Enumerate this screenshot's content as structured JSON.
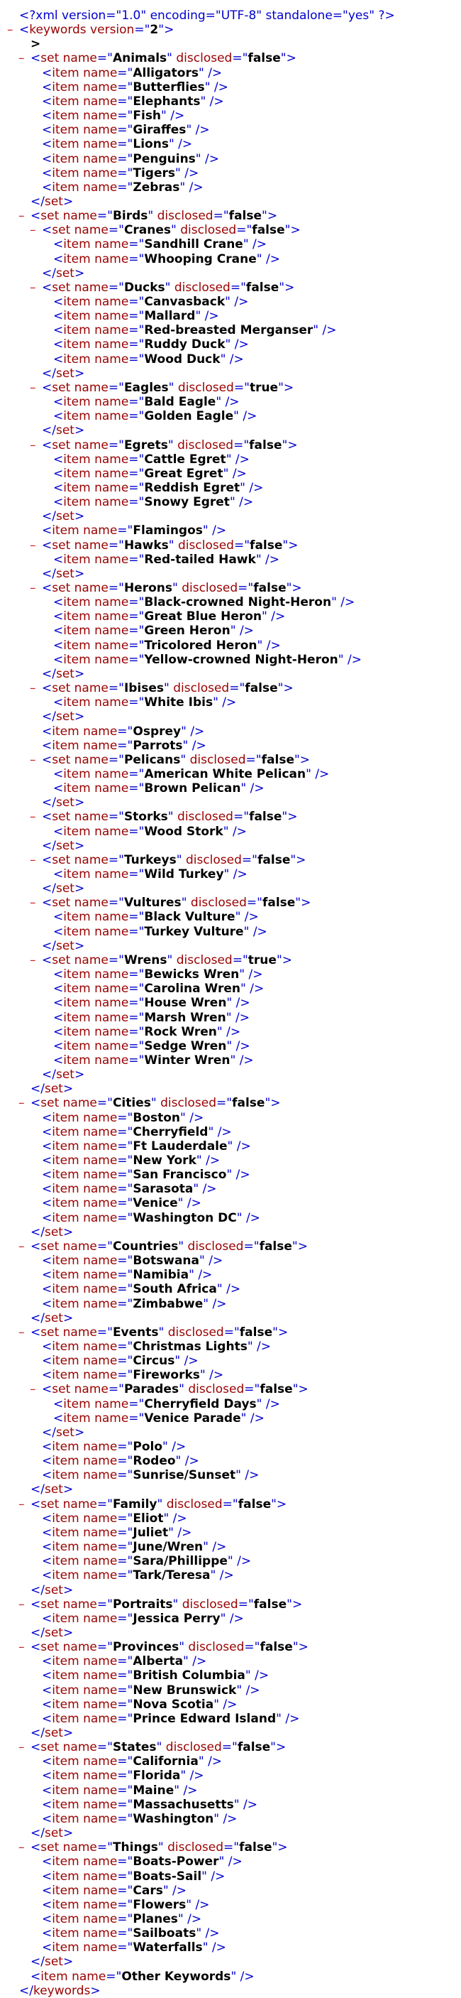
{
  "declaration": "<?xml version=\"1.0\" encoding=\"UTF-8\" standalone=\"yes\" ?>",
  "toggle_symbol": "–",
  "root": {
    "tag": "keywords",
    "attr": "version",
    "value": "2",
    "stray": ">"
  },
  "sets": [
    {
      "name": "Animals",
      "disclosed": "false",
      "children": [
        {
          "item": "Alligators"
        },
        {
          "item": "Butterflies"
        },
        {
          "item": "Elephants"
        },
        {
          "item": "Fish"
        },
        {
          "item": "Giraffes"
        },
        {
          "item": "Lions"
        },
        {
          "item": "Penguins"
        },
        {
          "item": "Tigers"
        },
        {
          "item": "Zebras"
        }
      ]
    },
    {
      "name": "Birds",
      "disclosed": "false",
      "children": [
        {
          "set": {
            "name": "Cranes",
            "disclosed": "false",
            "items": [
              "Sandhill Crane",
              "Whooping Crane"
            ]
          }
        },
        {
          "set": {
            "name": "Ducks",
            "disclosed": "false",
            "items": [
              "Canvasback",
              "Mallard",
              "Red-breasted Merganser",
              "Ruddy Duck",
              "Wood Duck"
            ]
          }
        },
        {
          "set": {
            "name": "Eagles",
            "disclosed": "true",
            "items": [
              "Bald Eagle",
              "Golden Eagle"
            ]
          }
        },
        {
          "set": {
            "name": "Egrets",
            "disclosed": "false",
            "items": [
              "Cattle Egret",
              "Great Egret",
              "Reddish Egret",
              "Snowy Egret"
            ]
          }
        },
        {
          "item": "Flamingos"
        },
        {
          "set": {
            "name": "Hawks",
            "disclosed": "false",
            "items": [
              "Red-tailed Hawk"
            ]
          }
        },
        {
          "set": {
            "name": "Herons",
            "disclosed": "false",
            "items": [
              "Black-crowned Night-Heron",
              "Great Blue Heron",
              "Green Heron",
              "Tricolored Heron",
              "Yellow-crowned Night-Heron"
            ]
          }
        },
        {
          "set": {
            "name": "Ibises",
            "disclosed": "false",
            "items": [
              "White Ibis"
            ]
          }
        },
        {
          "item": "Osprey"
        },
        {
          "item": "Parrots"
        },
        {
          "set": {
            "name": "Pelicans",
            "disclosed": "false",
            "items": [
              "American White Pelican",
              "Brown Pelican"
            ]
          }
        },
        {
          "set": {
            "name": "Storks",
            "disclosed": "false",
            "items": [
              "Wood Stork"
            ]
          }
        },
        {
          "set": {
            "name": "Turkeys",
            "disclosed": "false",
            "items": [
              "Wild Turkey"
            ]
          }
        },
        {
          "set": {
            "name": "Vultures",
            "disclosed": "false",
            "items": [
              "Black Vulture",
              "Turkey Vulture"
            ]
          }
        },
        {
          "set": {
            "name": "Wrens",
            "disclosed": "true",
            "items": [
              "Bewicks Wren",
              "Carolina Wren",
              "House Wren",
              "Marsh Wren",
              "Rock Wren",
              "Sedge Wren",
              "Winter Wren"
            ]
          }
        }
      ]
    },
    {
      "name": "Cities",
      "disclosed": "false",
      "children": [
        {
          "item": "Boston"
        },
        {
          "item": "Cherryfield"
        },
        {
          "item": "Ft Lauderdale"
        },
        {
          "item": "New York"
        },
        {
          "item": "San Francisco"
        },
        {
          "item": "Sarasota"
        },
        {
          "item": "Venice"
        },
        {
          "item": "Washington DC"
        }
      ]
    },
    {
      "name": "Countries",
      "disclosed": "false",
      "children": [
        {
          "item": "Botswana"
        },
        {
          "item": "Namibia"
        },
        {
          "item": "South Africa"
        },
        {
          "item": "Zimbabwe"
        }
      ]
    },
    {
      "name": "Events",
      "disclosed": "false",
      "children": [
        {
          "item": "Christmas Lights"
        },
        {
          "item": "Circus"
        },
        {
          "item": "Fireworks"
        },
        {
          "set": {
            "name": "Parades",
            "disclosed": "false",
            "items": [
              "Cherryfield Days",
              "Venice Parade"
            ]
          }
        },
        {
          "item": "Polo"
        },
        {
          "item": "Rodeo"
        },
        {
          "item": "Sunrise/Sunset"
        }
      ]
    },
    {
      "name": "Family",
      "disclosed": "false",
      "children": [
        {
          "item": "Eliot"
        },
        {
          "item": "Juliet"
        },
        {
          "item": "June/Wren"
        },
        {
          "item": "Sara/Phillippe"
        },
        {
          "item": "Tark/Teresa"
        }
      ]
    },
    {
      "name": "Portraits",
      "disclosed": "false",
      "children": [
        {
          "item": "Jessica Perry"
        }
      ]
    },
    {
      "name": "Provinces",
      "disclosed": "false",
      "children": [
        {
          "item": "Alberta"
        },
        {
          "item": "British Columbia"
        },
        {
          "item": "New Brunswick"
        },
        {
          "item": "Nova Scotia"
        },
        {
          "item": "Prince Edward Island"
        }
      ]
    },
    {
      "name": "States",
      "disclosed": "false",
      "children": [
        {
          "item": "California"
        },
        {
          "item": "Florida"
        },
        {
          "item": "Maine"
        },
        {
          "item": "Massachusetts"
        },
        {
          "item": "Washington"
        }
      ]
    },
    {
      "name": "Things",
      "disclosed": "false",
      "children": [
        {
          "item": "Boats-Power"
        },
        {
          "item": "Boats-Sail"
        },
        {
          "item": "Cars"
        },
        {
          "item": "Flowers"
        },
        {
          "item": "Planes"
        },
        {
          "item": "Sailboats"
        },
        {
          "item": "Waterfalls"
        }
      ]
    }
  ],
  "trailing_item": "Other Keywords",
  "colors": {
    "markup": "#0000cc",
    "name": "#990000",
    "value": "#000000",
    "toggle": "#cc2222"
  }
}
